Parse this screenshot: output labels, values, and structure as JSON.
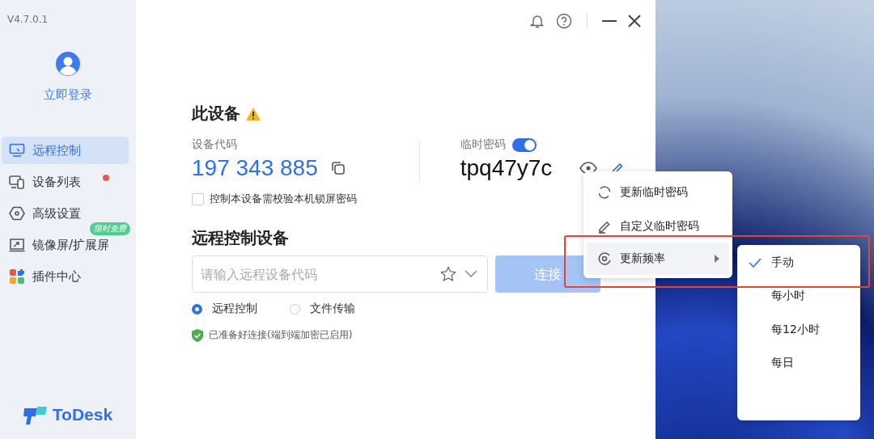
{
  "sidebar": {
    "version": "V4.7.0.1",
    "login": "立即登录",
    "items": [
      {
        "label": "远程控制",
        "selected": true,
        "dot": false
      },
      {
        "label": "设备列表",
        "selected": false,
        "dot": true
      },
      {
        "label": "高级设置",
        "selected": false,
        "dot": false
      },
      {
        "label": "镜像屏/扩展屏",
        "selected": false,
        "dot": false,
        "badge": "限时免费"
      },
      {
        "label": "插件中心",
        "selected": false,
        "dot": false
      }
    ],
    "brand": "ToDesk"
  },
  "this_device": {
    "title": "此设备",
    "warning": true,
    "code_label": "设备代码",
    "code": "197 343 885",
    "password_label": "临时密码",
    "password_enabled": true,
    "password": "tpq47y7c",
    "lock_check": {
      "label": "控制本设备需校验本机锁屏密码",
      "checked": false
    }
  },
  "remote": {
    "title": "远程控制设备",
    "placeholder": "请输入远程设备代码",
    "connect": "连接",
    "modes": [
      {
        "label": "远程控制",
        "selected": true
      },
      {
        "label": "文件传输",
        "selected": false
      }
    ],
    "status": "已准备好连接(端到端加密已启用)"
  },
  "menu": {
    "items": [
      {
        "label": "更新临时密码",
        "submenu": false,
        "hover": false
      },
      {
        "label": "自定义临时密码",
        "submenu": false,
        "hover": false
      },
      {
        "label": "更新频率",
        "submenu": true,
        "hover": true
      }
    ]
  },
  "submenu": {
    "items": [
      {
        "label": "手动",
        "selected": true
      },
      {
        "label": "每小时",
        "selected": false
      },
      {
        "label": "每12小时",
        "selected": false
      },
      {
        "label": "每日",
        "selected": false
      }
    ]
  },
  "annotation": {
    "kind": "highlight-rect"
  }
}
